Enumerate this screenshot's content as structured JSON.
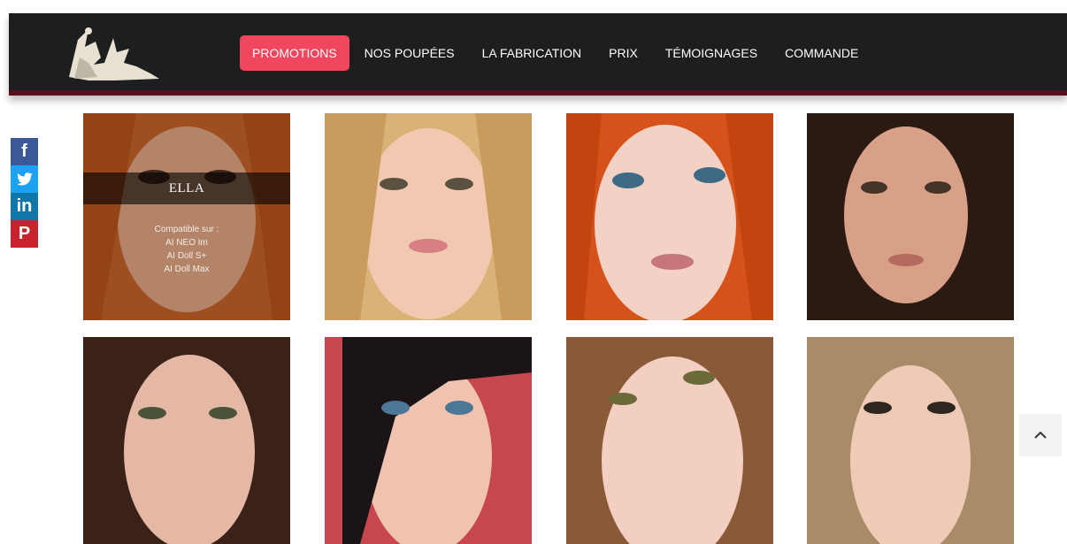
{
  "nav": {
    "items": [
      {
        "label": "PROMOTIONS",
        "active": true
      },
      {
        "label": "NOS POUPÉES",
        "active": false
      },
      {
        "label": "LA FABRICATION",
        "active": false
      },
      {
        "label": "PRIX",
        "active": false
      },
      {
        "label": "TÉMOIGNAGES",
        "active": false
      },
      {
        "label": "COMMANDE",
        "active": false
      }
    ]
  },
  "social": {
    "facebook": "f",
    "twitter": "twitter-bird-icon",
    "linkedin": "in",
    "pinterest": "P"
  },
  "featured": {
    "name": "ELLA",
    "compat_title": "Compatible sur :",
    "compat_1": "AI NEO Im",
    "compat_2": "AI Doll S+",
    "compat_3": "AI Doll Max"
  },
  "colors": {
    "header_bg": "#1c1e20",
    "accent": "#f0465e",
    "header_border": "#5a0f1c"
  },
  "tiles": [
    {
      "icon": "doll-face-image",
      "hair": "#c8672a"
    },
    {
      "icon": "doll-face-image",
      "hair": "#d9b277"
    },
    {
      "icon": "doll-face-image",
      "hair": "#d5531a"
    },
    {
      "icon": "doll-face-image",
      "hair": "#2a1a12"
    },
    {
      "icon": "doll-face-image",
      "hair": "#3a2218"
    },
    {
      "icon": "doll-face-image",
      "hair": "#1a1416"
    },
    {
      "icon": "doll-face-image",
      "hair": "#8a5a38"
    },
    {
      "icon": "doll-face-image",
      "hair": "#b08a5e"
    }
  ]
}
